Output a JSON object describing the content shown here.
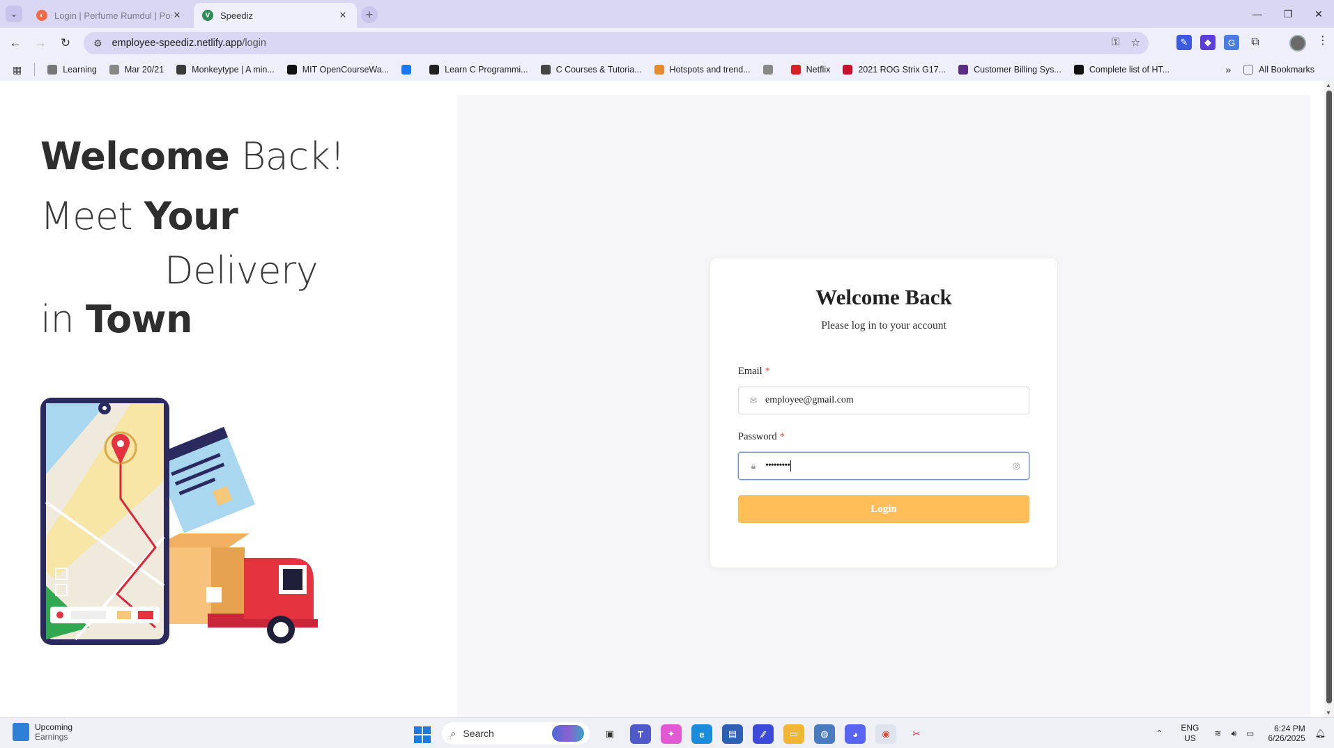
{
  "browser": {
    "tabs": [
      {
        "title": "Login | Perfume Rumdul | Post...",
        "favicon_color": "#ef6c4a"
      },
      {
        "title": "Speediz",
        "favicon_color": "#2e8b57"
      }
    ],
    "url_host": "employee-speediz.netlify.app",
    "url_path": "/login",
    "bookmarks": [
      {
        "label": "Learning",
        "icon": "folder-icon",
        "color": "#777777"
      },
      {
        "label": "Mar 20/21",
        "icon": "globe-icon",
        "color": "#888888"
      },
      {
        "label": "Monkeytype | A min...",
        "icon": "monkeytype-icon",
        "color": "#3b3b3b"
      },
      {
        "label": "MIT OpenCourseWa...",
        "icon": "mit-icon",
        "color": "#111111"
      },
      {
        "label": "",
        "icon": "facebook-icon",
        "color": "#1877f2"
      },
      {
        "label": "Learn C Programmi...",
        "icon": "learnc-icon",
        "color": "#222222"
      },
      {
        "label": "C Courses & Tutoria...",
        "icon": "c-courses-icon",
        "color": "#444444"
      },
      {
        "label": "Hotspots and trend...",
        "icon": "hotspots-icon",
        "color": "#e58a2e"
      },
      {
        "label": "",
        "icon": "globe-icon",
        "color": "#888888"
      },
      {
        "label": "Netflix",
        "icon": "netflix-icon",
        "color": "#d81f26"
      },
      {
        "label": "2021 ROG Strix G17...",
        "icon": "rog-icon",
        "color": "#c8102e"
      },
      {
        "label": "Customer Billing Sys...",
        "icon": "billing-icon",
        "color": "#5b2c83"
      },
      {
        "label": "Complete list of HT...",
        "icon": "ff-icon",
        "color": "#111111"
      }
    ],
    "all_bookmarks": "All Bookmarks"
  },
  "hero": {
    "line1_bold": "Welcome",
    "line1_light": " Back!",
    "line2_light": "Meet ",
    "line2_bold": "Your",
    "line3_light": "Delivery",
    "line4_light": "in ",
    "line4_bold": "Town"
  },
  "login_card": {
    "title": "Welcome Back",
    "subtitle": "Please log in to your account",
    "email_label": "Email",
    "email_value": "employee@gmail.com",
    "password_label": "Password",
    "password_value": "•••••••••",
    "required_mark": "*",
    "login_button": "Login"
  },
  "colors": {
    "accent": "#ffbe58",
    "required": "#e05252",
    "panel_bg": "#f7f7fa"
  },
  "taskbar": {
    "weather_title": "Upcoming",
    "weather_sub": "Earnings",
    "search_placeholder": "Search",
    "lang_top": "ENG",
    "lang_bottom": "US",
    "time": "6:24 PM",
    "date": "6/26/2025"
  }
}
